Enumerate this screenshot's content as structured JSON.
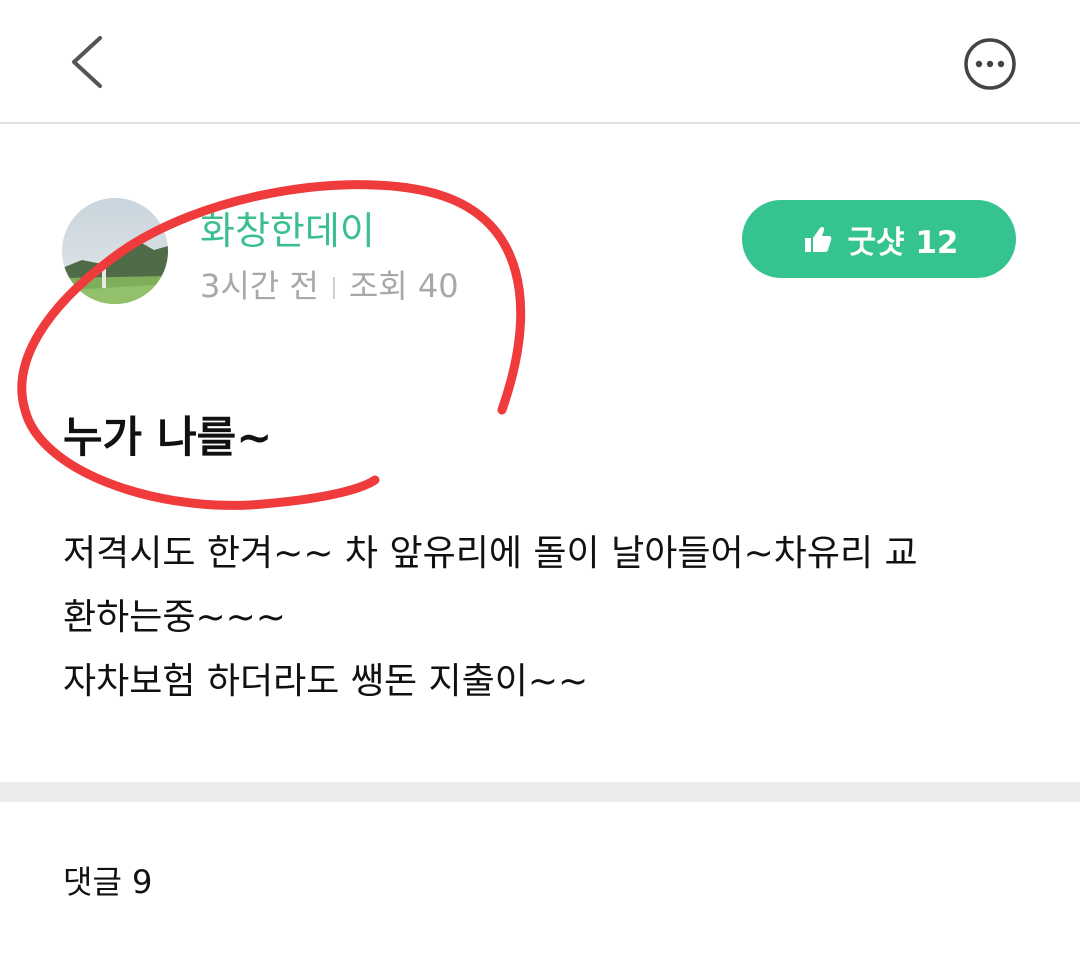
{
  "header": {
    "back_icon": "chevron-left-icon",
    "more_icon": "more-horizontal-circle-icon"
  },
  "author": {
    "name": "화창한데이",
    "time": "3시간 전",
    "views": "조회 40",
    "avatar_icon": "profile-photo-landscape"
  },
  "goodshot": {
    "icon": "thumbs-up-hand-icon",
    "label": "굿샷 12"
  },
  "post": {
    "title": "누가 나를~",
    "body_lines": [
      "저격시도  한겨~~ 차 앞유리에 돌이 날아들어~차유리 교",
      "환하는중~~~",
      "자차보험 하더라도 쌩돈 지출이~~"
    ]
  },
  "comments": {
    "header": "댓글 9"
  },
  "colors": {
    "accent": "#35c38f",
    "author_green": "#3cbf8e",
    "annotation_red": "#ef3b3b"
  }
}
